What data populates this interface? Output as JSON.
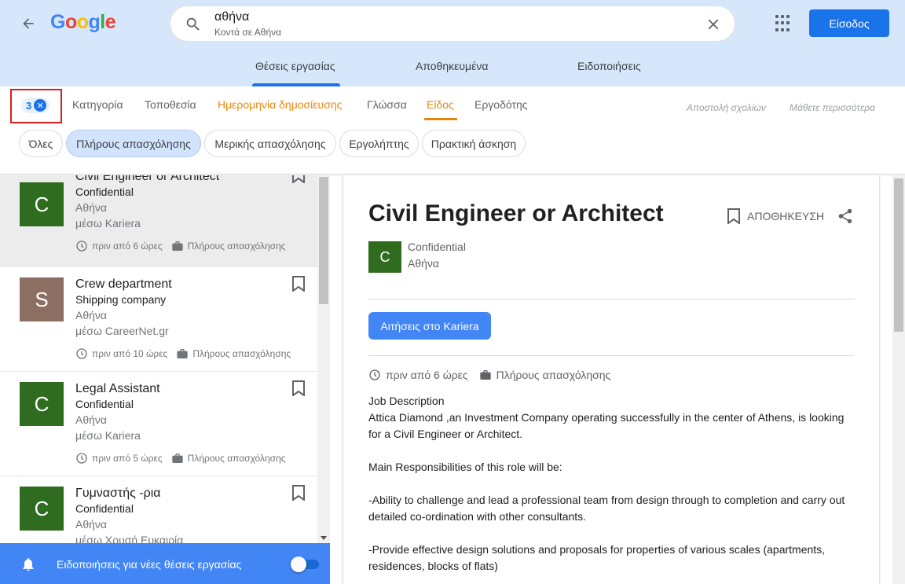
{
  "header": {
    "logo": {
      "letters": [
        "G",
        "o",
        "o",
        "g",
        "l",
        "e"
      ],
      "colors": [
        "#4285f4",
        "#ea4335",
        "#fbbc05",
        "#4285f4",
        "#34a853",
        "#ea4335"
      ]
    },
    "search": {
      "query": "αθήνα",
      "subtitle": "Κοντά σε Αθήνα"
    },
    "signin_label": "Είσοδος"
  },
  "main_tabs": [
    {
      "label": "Θέσεις εργασίας",
      "active": true
    },
    {
      "label": "Αποθηκευμένα",
      "active": false
    },
    {
      "label": "Ειδοποιήσεις",
      "active": false
    }
  ],
  "filters": {
    "active_count": "3",
    "tabs": [
      {
        "label": "Κατηγορία"
      },
      {
        "label": "Τοποθεσία"
      },
      {
        "label": "Ημερομηνία δημοσίευσης"
      },
      {
        "label": "Γλώσσα"
      },
      {
        "label": "Είδος"
      },
      {
        "label": "Εργοδότης"
      }
    ],
    "feedback_label": "Αποστολή σχολίων",
    "learn_more_label": "Μάθετε περισσότερα",
    "chips": [
      {
        "label": "Όλες",
        "selected": false
      },
      {
        "label": "Πλήρους απασχόλησης",
        "selected": true
      },
      {
        "label": "Μερικής απασχόλησης",
        "selected": false
      },
      {
        "label": "Εργολήπτης",
        "selected": false
      },
      {
        "label": "Πρακτική άσκηση",
        "selected": false
      }
    ]
  },
  "jobs": [
    {
      "initial": "C",
      "avatar_color": "#2f6c1f",
      "title": "Civil Engineer or Architect",
      "company": "Confidential",
      "location": "Αθήνα",
      "via": "μέσω Kariera",
      "posted": "πριν από 6 ώρες",
      "type": "Πλήρους απασχόλησης",
      "active": true
    },
    {
      "initial": "S",
      "avatar_color": "#8d6e63",
      "title": "Crew department",
      "company": "Shipping company",
      "location": "Αθήνα",
      "via": "μέσω CareerNet.gr",
      "posted": "πριν από 10 ώρες",
      "type": "Πλήρους απασχόλησης",
      "active": false
    },
    {
      "initial": "C",
      "avatar_color": "#2f6c1f",
      "title": "Legal Assistant",
      "company": "Confidential",
      "location": "Αθήνα",
      "via": "μέσω Kariera",
      "posted": "πριν από 5 ώρες",
      "type": "Πλήρους απασχόλησης",
      "active": false
    },
    {
      "initial": "C",
      "avatar_color": "#2f6c1f",
      "title": "Γυμναστής -ρια",
      "company": "Confidential",
      "location": "Αθήνα",
      "via": "μέσω Χρυσή Ευκαιρία",
      "posted": "",
      "type": "",
      "active": false
    }
  ],
  "notification_bar": {
    "label": "Ειδοποιήσεις για νέες θέσεις εργασίας",
    "enabled": true
  },
  "detail": {
    "title": "Civil Engineer or Architect",
    "save_label": "ΑΠΟΘΗΚΕΥΣΗ",
    "initial": "C",
    "company": "Confidential",
    "location": "Αθήνα",
    "apply_label": "Αιτήσεις στο Kariera",
    "posted": "πριν από 6 ώρες",
    "type": "Πλήρους απασχόλησης",
    "description": [
      "Job Description",
      "Attica Diamond ,an Investment Company operating successfully in the center of Athens, is looking for a Civil Engineer or Architect.",
      "",
      "Main Responsibilities of this role will be:",
      "",
      "-Ability to challenge and lead a professional team from design through to completion and carry out detailed co-ordination with other consultants.",
      "",
      "-Provide effective design solutions and proposals for properties of various scales (apartments, residences, blocks of flats)"
    ]
  },
  "colors": {
    "accent": "#1a73e8",
    "header_bg": "#d6e7fb",
    "filter_active": "#e8870c",
    "notify_bg": "#4285f4"
  }
}
